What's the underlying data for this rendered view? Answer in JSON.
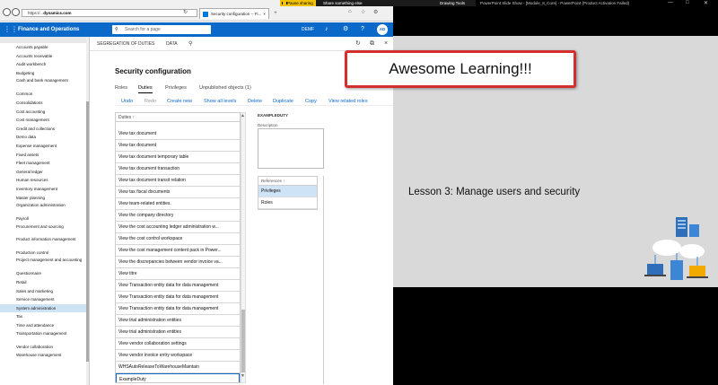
{
  "browser": {
    "address": "https://...",
    "address_bold": "dynamics.com",
    "tab_label": "Security configuration -- Fi...",
    "close": "×",
    "new_tab": "+"
  },
  "recorder": {
    "pause": "Pause sharing",
    "share": "Share something else",
    "drawing_tools": "Drawing Tools",
    "ppt_title": "PowerPoint Slide Show - [Module_8_Core] - PowerPoint (Product Activation Failed)"
  },
  "d365": {
    "app_title": "Finance and Operations",
    "search_placeholder": "Search for a page",
    "company": "DEMF",
    "avatar": "AD"
  },
  "sidebar": {
    "items": [
      "Accounts payable",
      "Accounts receivable",
      "Audit workbench",
      "Budgeting",
      "Cash and bank management",
      "Common",
      "Consolidations",
      "Cost accounting",
      "Cost management",
      "Credit and collections",
      "Demo data",
      "Expense management",
      "Fixed assets",
      "Fleet management",
      "General ledger",
      "Human resources",
      "Inventory management",
      "Master planning",
      "Organization administration",
      "Payroll",
      "Procurement and sourcing",
      "Product information management",
      "Production control",
      "Project management and accounting",
      "Questionnaire",
      "Retail",
      "Sales and marketing",
      "Service management",
      "System administration",
      "Tax",
      "Time and attendance",
      "Transportation management",
      "Vendor collaboration",
      "Warehouse management"
    ]
  },
  "breadcrumb": {
    "part1": "SEGREGATION OF DUTIES",
    "part2": "DATA"
  },
  "page": {
    "title": "Security configuration",
    "tabs": [
      "Roles",
      "Duties",
      "Privileges",
      "Unpublished objects (1)"
    ],
    "actions": [
      "Undo",
      "Redo",
      "Create new",
      "Show all levels",
      "Delete",
      "Duplicate",
      "Copy",
      "View related roles"
    ]
  },
  "grid": {
    "header": "Duties ↑",
    "rows": [
      "View tax document",
      "View tax document",
      "View tax document temporary table",
      "View tax document transaction",
      "View tax document transit relation",
      "View tax fiscal documents",
      "View team-related entities.",
      "View the company directory",
      "View the cost accounting ledger administration w...",
      "View the cost control workspace",
      "View the cost management content pack in Power...",
      "View the discrepancies between vendor invoice va...",
      "View titre",
      "View Transaction entity data for data management",
      "View Transaction entity data for data management",
      "View Transaction entity data for data management",
      "View trial administration entities",
      "View trial administration entities",
      "View vendor collaboration settings",
      "View vendor invoice entry workspace",
      "WHSAutoReleaseToWarehouseMaintain",
      "ExampleDuty"
    ]
  },
  "details": {
    "section": "EXAMPLEDUTY",
    "description_label": "Description",
    "references_header": "References ↑",
    "references": [
      "Privileges",
      "Roles"
    ]
  },
  "callout": "Awesome Learning!!!",
  "slide": {
    "lesson": "Lesson 3: Manage users and security"
  },
  "colors": {
    "d365_blue": "#0b6ac9",
    "callout_border": "#d32f2f",
    "slide_bg": "#d9d9d9"
  }
}
